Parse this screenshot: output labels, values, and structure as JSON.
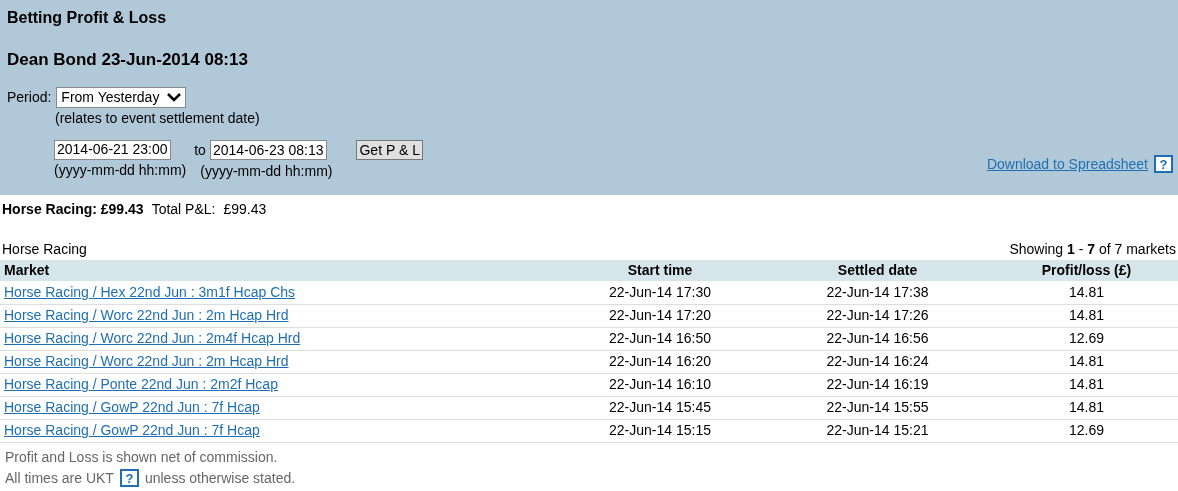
{
  "page_title": "Betting Profit & Loss",
  "account_line": "Dean Bond 23-Jun-2014 08:13",
  "period": {
    "label": "Period:",
    "value": "From Yesterday",
    "note": "(relates to event settlement date)"
  },
  "from": {
    "value": "2014-06-21 23:00",
    "hint": "(yyyy-mm-dd hh:mm)"
  },
  "to_label": "to",
  "to": {
    "value": "2014-06-23 08:13",
    "hint": "(yyyy-mm-dd hh:mm)"
  },
  "get_button": "Get P & L",
  "download_link": "Download to Spreadsheet",
  "help_mark": "?",
  "summary": {
    "sport_total": "Horse Racing: £99.43",
    "total_label": "Total P&L:",
    "total_value": "£99.43"
  },
  "section_title": "Horse Racing",
  "showing": "Showing **1** - **7** of 7 markets",
  "table": {
    "columns": [
      "Market",
      "Start time",
      "Settled date",
      "Profit/loss (£)"
    ],
    "rows": [
      {
        "market": "Horse Racing / Hex 22nd Jun : 3m1f Hcap Chs",
        "start": "22-Jun-14 17:30",
        "settled": "22-Jun-14 17:38",
        "pl": "14.81"
      },
      {
        "market": "Horse Racing / Worc 22nd Jun : 2m Hcap Hrd",
        "start": "22-Jun-14 17:20",
        "settled": "22-Jun-14 17:26",
        "pl": "14.81"
      },
      {
        "market": "Horse Racing / Worc 22nd Jun : 2m4f Hcap Hrd",
        "start": "22-Jun-14 16:50",
        "settled": "22-Jun-14 16:56",
        "pl": "12.69"
      },
      {
        "market": "Horse Racing / Worc 22nd Jun : 2m Hcap Hrd",
        "start": "22-Jun-14 16:20",
        "settled": "22-Jun-14 16:24",
        "pl": "14.81"
      },
      {
        "market": "Horse Racing / Ponte 22nd Jun : 2m2f Hcap",
        "start": "22-Jun-14 16:10",
        "settled": "22-Jun-14 16:19",
        "pl": "14.81"
      },
      {
        "market": "Horse Racing / GowP 22nd Jun : 7f Hcap",
        "start": "22-Jun-14 15:45",
        "settled": "22-Jun-14 15:55",
        "pl": "14.81"
      },
      {
        "market": "Horse Racing / GowP 22nd Jun : 7f Hcap",
        "start": "22-Jun-14 15:15",
        "settled": "22-Jun-14 15:21",
        "pl": "12.69"
      }
    ]
  },
  "footer": {
    "line1": "Profit and Loss is shown net of commission.",
    "line2_before": "All times are UKT",
    "help_mark": "?",
    "line2_after": "unless otherwise stated."
  }
}
